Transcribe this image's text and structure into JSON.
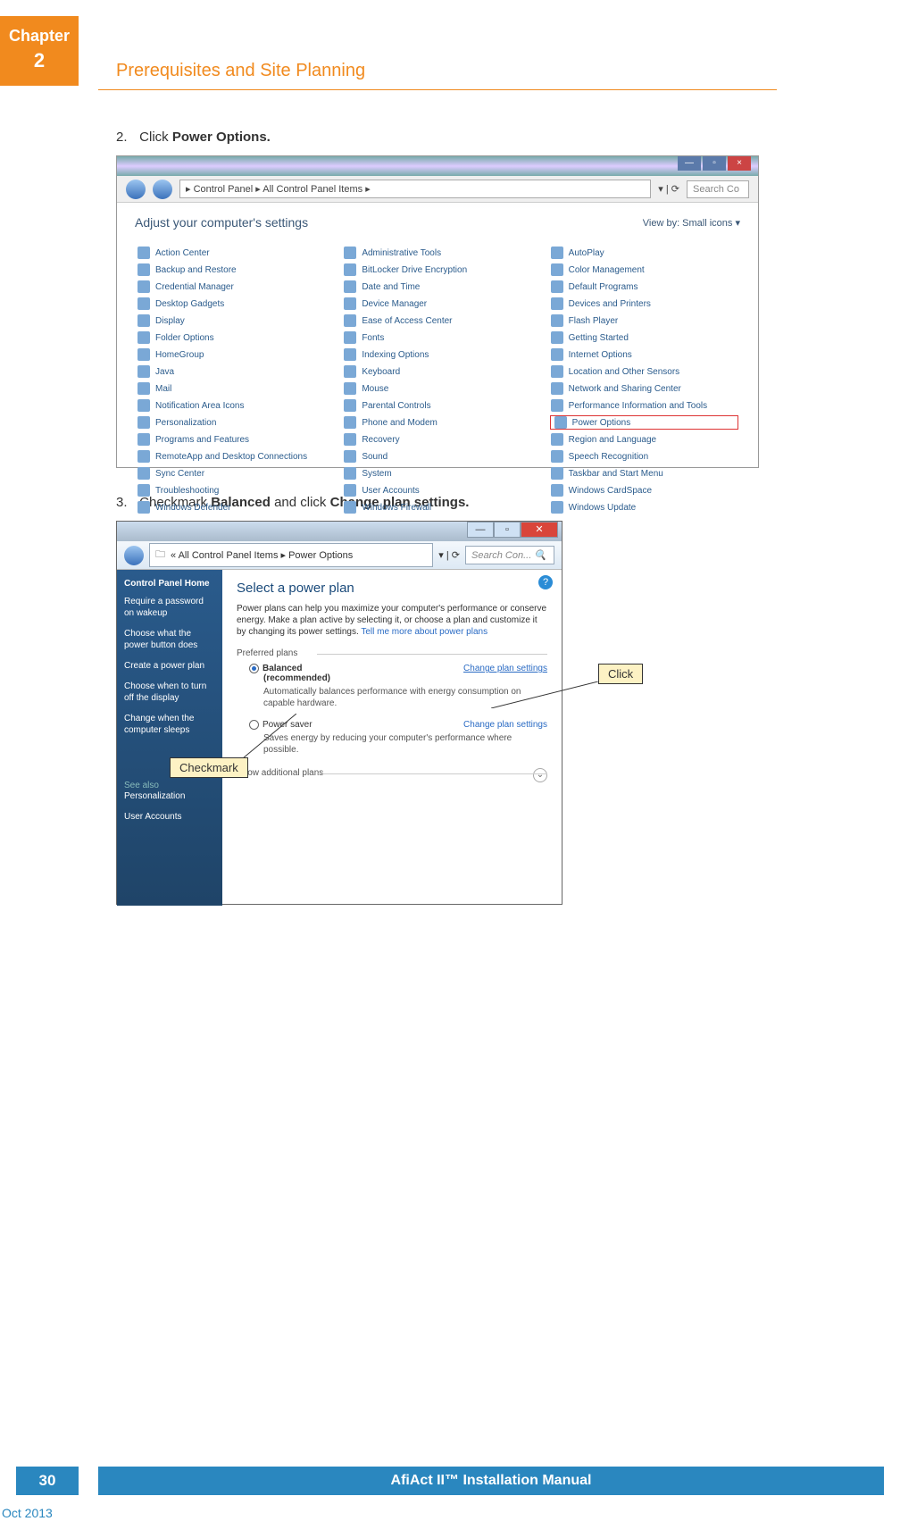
{
  "chapter": {
    "label": "Chapter",
    "num": "2"
  },
  "section_title": "Prerequisites and Site Planning",
  "step2": {
    "num": "2.",
    "pre": "Click ",
    "bold": "Power Options."
  },
  "step3": {
    "num": "3.",
    "pre": "Checkmark ",
    "b1": "Balanced",
    "mid": " and click ",
    "b2": "Change plan settings."
  },
  "shot1": {
    "breadcrumb": "▸ Control Panel ▸ All Control Panel Items ▸",
    "search": "Search Co",
    "heading": "Adjust your computer's settings",
    "viewby": "View by:   Small icons ▾",
    "items": [
      "Action Center",
      "Administrative Tools",
      "AutoPlay",
      "Backup and Restore",
      "BitLocker Drive Encryption",
      "Color Management",
      "Credential Manager",
      "Date and Time",
      "Default Programs",
      "Desktop Gadgets",
      "Device Manager",
      "Devices and Printers",
      "Display",
      "Ease of Access Center",
      "Flash Player",
      "Folder Options",
      "Fonts",
      "Getting Started",
      "HomeGroup",
      "Indexing Options",
      "Internet Options",
      "Java",
      "Keyboard",
      "Location and Other Sensors",
      "Mail",
      "Mouse",
      "Network and Sharing Center",
      "Notification Area Icons",
      "Parental Controls",
      "Performance Information and Tools",
      "Personalization",
      "Phone and Modem",
      "Power Options",
      "Programs and Features",
      "Recovery",
      "Region and Language",
      "RemoteApp and Desktop Connections",
      "Sound",
      "Speech Recognition",
      "Sync Center",
      "System",
      "Taskbar and Start Menu",
      "Troubleshooting",
      "User Accounts",
      "Windows CardSpace",
      "Windows Defender",
      "Windows Firewall",
      "Windows Update"
    ],
    "highlight": "Power Options"
  },
  "shot2": {
    "breadcrumb": "« All Control Panel Items ▸ Power Options",
    "search": "Search Con... ",
    "side_hd": "Control Panel Home",
    "side_links": [
      "Require a password on wakeup",
      "Choose what the power button does",
      "Create a power plan",
      "Choose when to turn off the display",
      "Change when the computer sleeps"
    ],
    "seealso": "See also",
    "seealso_items": [
      "Personalization",
      "User Accounts"
    ],
    "main_h": "Select a power plan",
    "main_desc": "Power plans can help you maximize your computer's performance or conserve energy. Make a plan active by selecting it, or choose a plan and customize it by changing its power settings. ",
    "tellmore": "Tell me more about power plans",
    "preferred": "Preferred plans",
    "plan1": {
      "name": "Balanced",
      "rec": "(recommended)",
      "cps": "Change plan settings",
      "desc": "Automatically balances performance with energy consumption on capable hardware."
    },
    "plan2": {
      "name": "Power saver",
      "cps": "Change plan settings",
      "desc": "Saves energy by reducing your computer's performance where possible."
    },
    "showadd": "Show additional plans"
  },
  "callouts": {
    "checkmark": "Checkmark",
    "click": "Click"
  },
  "footer": {
    "page": "30",
    "title": "AfiAct II™ Installation Manual",
    "date": "Oct 2013"
  }
}
